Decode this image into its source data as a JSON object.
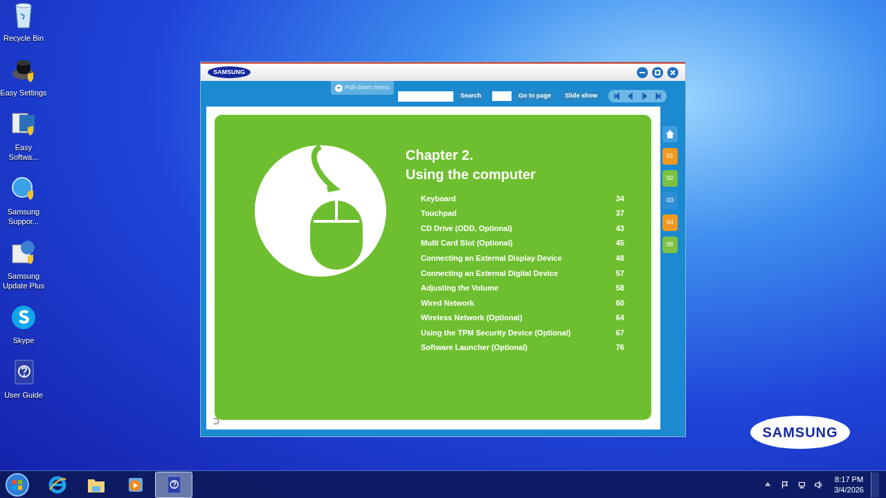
{
  "desktop_icons": [
    {
      "kind": "recycle",
      "label": "Recycle Bin"
    },
    {
      "kind": "settings",
      "label": "Easy Settings"
    },
    {
      "kind": "software",
      "label": "Easy Softwa..."
    },
    {
      "kind": "globe",
      "label": "Samsung Suppor..."
    },
    {
      "kind": "update",
      "label": "Samsung Update Plus"
    },
    {
      "kind": "skype",
      "label": "Skype"
    },
    {
      "kind": "guide",
      "label": "User Guide"
    }
  ],
  "desktop_logo": "SAMSUNG",
  "window": {
    "logo": "SAMSUNG",
    "toolbar": {
      "pulldown": "Pull-down menu",
      "search_button": "Search",
      "goto_button": "Go to page",
      "slideshow_button": "Slide show"
    },
    "chapter": {
      "title": "Chapter 2.",
      "subtitle": "Using the computer",
      "toc": [
        {
          "title": "Keyboard",
          "page": "34"
        },
        {
          "title": "Touchpad",
          "page": "37"
        },
        {
          "title": "CD Drive (ODD, Optional)",
          "page": "43"
        },
        {
          "title": "Multi Card Slot (Optional)",
          "page": "45"
        },
        {
          "title": "Connecting an External Display Device",
          "page": "48"
        },
        {
          "title": "Connecting an External Digital Device",
          "page": "57"
        },
        {
          "title": "Adjusting the Volume",
          "page": "58"
        },
        {
          "title": "Wired Network",
          "page": "60"
        },
        {
          "title": "Wireless Network (Optional)",
          "page": "64"
        },
        {
          "title": "Using the TPM Security Device (Optional)",
          "page": "67"
        },
        {
          "title": "Software Launcher (Optional)",
          "page": "76"
        }
      ]
    },
    "side_tabs": [
      {
        "kind": "home"
      },
      {
        "kind": "chapter",
        "label": "01",
        "color": "#f39a1e"
      },
      {
        "kind": "chapter",
        "label": "02",
        "color": "#7cc142"
      },
      {
        "kind": "chapter",
        "label": "03",
        "color": "#2f8fd6"
      },
      {
        "kind": "chapter",
        "label": "04",
        "color": "#f39a1e"
      },
      {
        "kind": "chapter",
        "label": "05",
        "color": "#7cc142"
      }
    ]
  },
  "taskbar": {
    "items": [
      {
        "kind": "ie",
        "selected": false
      },
      {
        "kind": "explorer",
        "selected": false
      },
      {
        "kind": "media",
        "selected": false
      },
      {
        "kind": "guide",
        "selected": true
      }
    ],
    "time": "8:17 PM",
    "date": "3/4/2026"
  }
}
